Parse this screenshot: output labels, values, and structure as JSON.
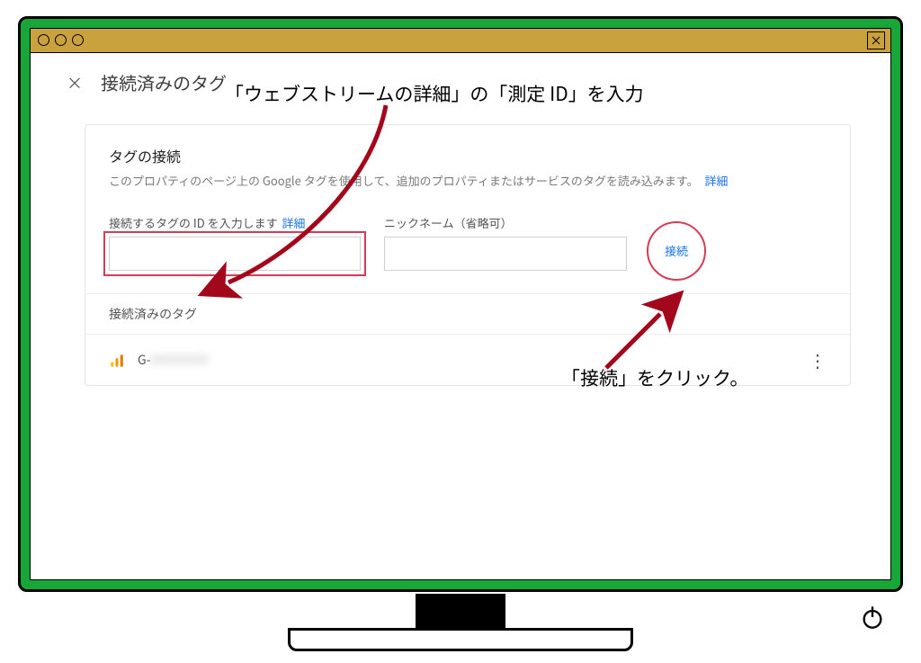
{
  "annotations": {
    "top": "「ウェブストリームの詳細」の「測定 ID」を入力",
    "right": "「接続」をクリック。"
  },
  "panel": {
    "close_glyph": "×",
    "title": "接続済みのタグ"
  },
  "section": {
    "title": "タグの接続",
    "desc_before": "このプロパティのページ上の Google タグを使用して、追加のプロパティまたはサービスのタグを読み込みます。",
    "desc_link": "詳細"
  },
  "form": {
    "id_label_before": "接続するタグの ID を入力します",
    "id_label_link": "詳細",
    "id_value": "",
    "nick_label": "ニックネーム（省略可）",
    "nick_value": "",
    "connect_label": "接続"
  },
  "connected": {
    "header": "接続済みのタグ",
    "id_prefix": "G-",
    "id_blurred": "XXXXXXXX"
  }
}
